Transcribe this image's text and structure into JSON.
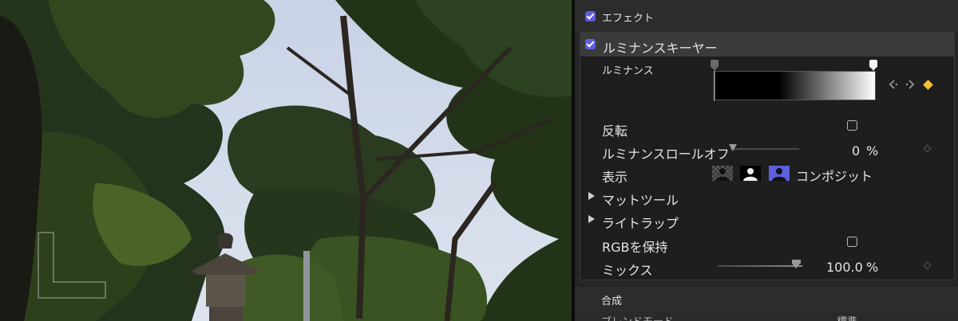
{
  "inspector": {
    "effects_label": "エフェクト",
    "luma_keyer": {
      "title": "ルミナンスキーヤー",
      "luminance_label": "ルミナンス",
      "invert_label": "反転",
      "rolloff_label": "ルミナンスロールオフ",
      "rolloff_value": "0",
      "rolloff_unit": "%",
      "view_label": "表示",
      "view_mode": "コンポジット",
      "matte_tools_label": "マットツール",
      "light_wrap_label": "ライトラップ",
      "preserve_rgb_label": "RGBを保持",
      "mix_label": "ミックス",
      "mix_value": "100.0",
      "mix_unit": "%"
    },
    "compositing_label": "合成",
    "blend_mode_label": "ブレンドモード",
    "blend_mode_value": "標準"
  },
  "controls": {
    "effects_checked": true,
    "luma_keyer_checked": true,
    "invert_checked": false,
    "preserve_rgb_checked": false,
    "rolloff_level": 0,
    "mix_level": 1.0
  },
  "colors": {
    "accent": "#5b5fe0",
    "keyframe": "#f2c037",
    "panel": "#262626"
  },
  "icons": [
    "checkbox-icon",
    "disclosure-triangle-icon",
    "previous-keyframe-icon",
    "next-keyframe-icon",
    "keyframe-diamond-icon",
    "matte-view-icon",
    "composite-view-icon",
    "keyframe-button-icon"
  ]
}
